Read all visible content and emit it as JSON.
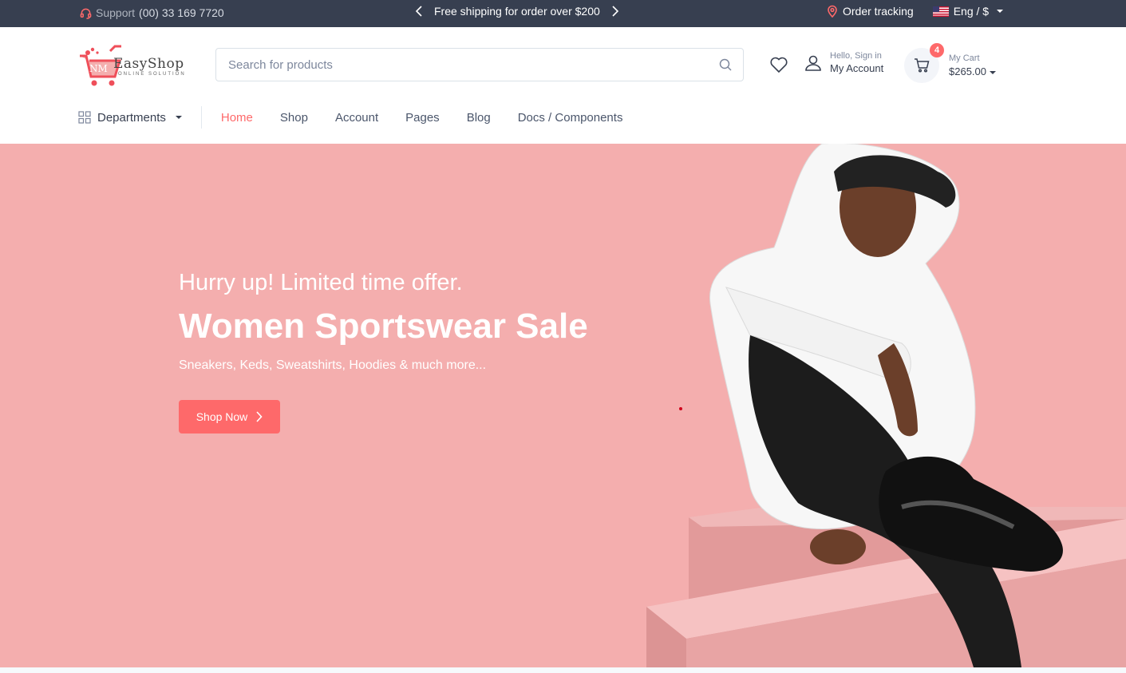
{
  "topbar": {
    "support_label": "Support",
    "support_phone": "(00) 33 169 7720",
    "promo": "Free shipping for order over $200",
    "order_tracking": "Order tracking",
    "lang_currency": "Eng / $"
  },
  "brand": {
    "name": "EasyShop",
    "tagline": "ONLINE SOLUTION",
    "mark": "NM"
  },
  "search": {
    "placeholder": "Search for products"
  },
  "account": {
    "greeting": "Hello, Sign in",
    "label": "My Account"
  },
  "cart": {
    "count": "4",
    "label": "My Cart",
    "total": "$265.00"
  },
  "nav": {
    "departments": "Departments",
    "links": [
      "Home",
      "Shop",
      "Account",
      "Pages",
      "Blog",
      "Docs / Components"
    ],
    "active": "Home"
  },
  "hero": {
    "subtitle": "Hurry up! Limited time offer.",
    "title": "Women Sportswear Sale",
    "description": "Sneakers, Keds, Sweatshirts, Hoodies & much more...",
    "cta": "Shop Now"
  },
  "colors": {
    "accent": "#fe696a",
    "topbar": "#373f50",
    "hero_bg": "#f4aeae"
  }
}
